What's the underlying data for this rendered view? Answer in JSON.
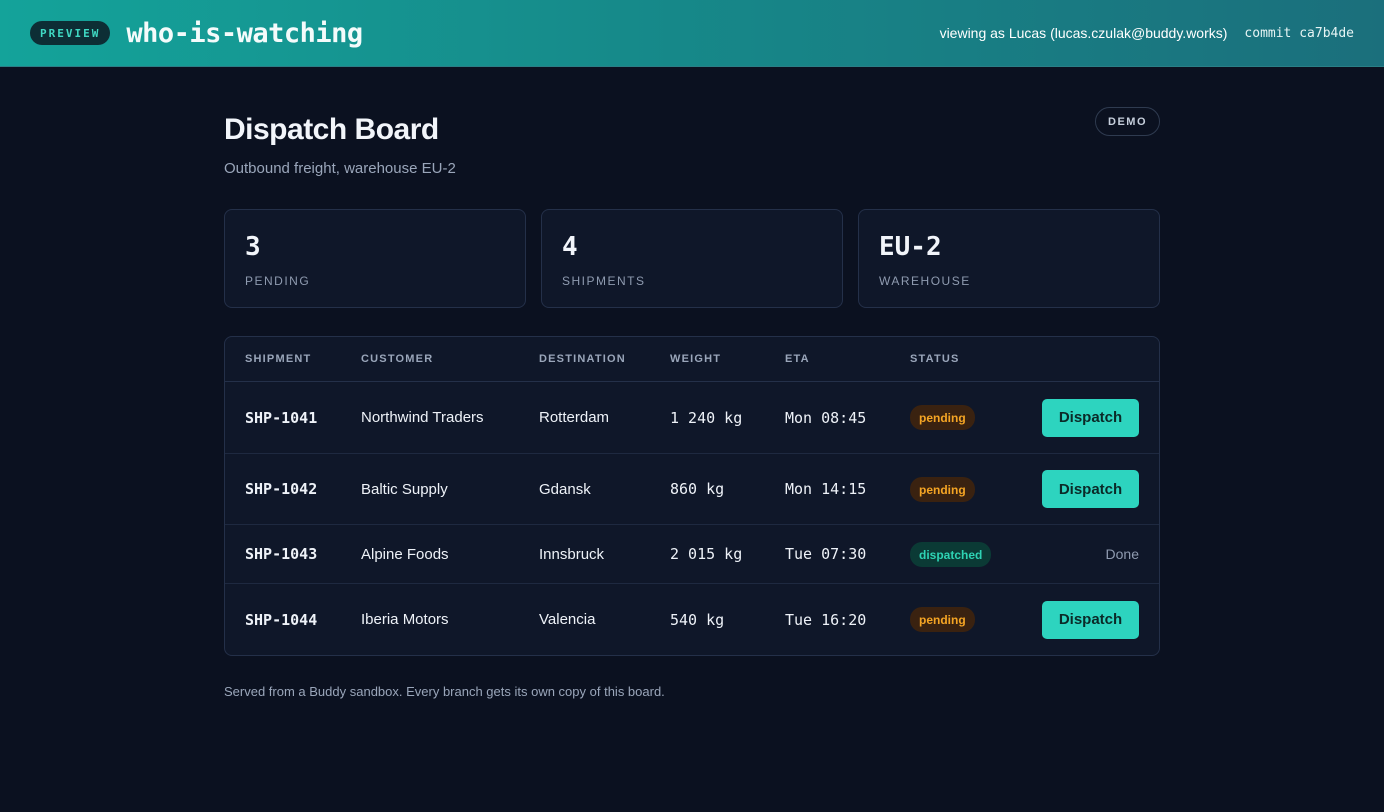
{
  "topbar": {
    "badge": "PREVIEW",
    "app_name": "who-is-watching",
    "viewer": "viewing as Lucas (lucas.czulak@buddy.works)",
    "commit": "commit ca7b4de"
  },
  "header": {
    "title": "Dispatch Board",
    "subtitle": "Outbound freight, warehouse EU-2",
    "demo_badge": "DEMO"
  },
  "stats": [
    {
      "value": "3",
      "label": "PENDING"
    },
    {
      "value": "4",
      "label": "SHIPMENTS"
    },
    {
      "value": "EU-2",
      "label": "WAREHOUSE"
    }
  ],
  "table": {
    "columns": [
      "SHIPMENT",
      "CUSTOMER",
      "DESTINATION",
      "WEIGHT",
      "ETA",
      "STATUS"
    ],
    "rows": [
      {
        "id": "SHP-1041",
        "customer": "Northwind Traders",
        "destination": "Rotterdam",
        "weight": "1 240 kg",
        "eta": "Mon 08:45",
        "status": "pending",
        "action": "Dispatch"
      },
      {
        "id": "SHP-1042",
        "customer": "Baltic Supply",
        "destination": "Gdansk",
        "weight": "860 kg",
        "eta": "Mon 14:15",
        "status": "pending",
        "action": "Dispatch"
      },
      {
        "id": "SHP-1043",
        "customer": "Alpine Foods",
        "destination": "Innsbruck",
        "weight": "2 015 kg",
        "eta": "Tue 07:30",
        "status": "dispatched",
        "action": "Done"
      },
      {
        "id": "SHP-1044",
        "customer": "Iberia Motors",
        "destination": "Valencia",
        "weight": "540 kg",
        "eta": "Tue 16:20",
        "status": "pending",
        "action": "Dispatch"
      }
    ]
  },
  "footer": {
    "note": "Served from a Buddy sandbox. Every branch gets its own copy of this board."
  },
  "colors": {
    "accent": "#2dd4bf",
    "pending": "#f5a524",
    "dispatched": "#2ed3b4",
    "background": "#0b1120"
  }
}
